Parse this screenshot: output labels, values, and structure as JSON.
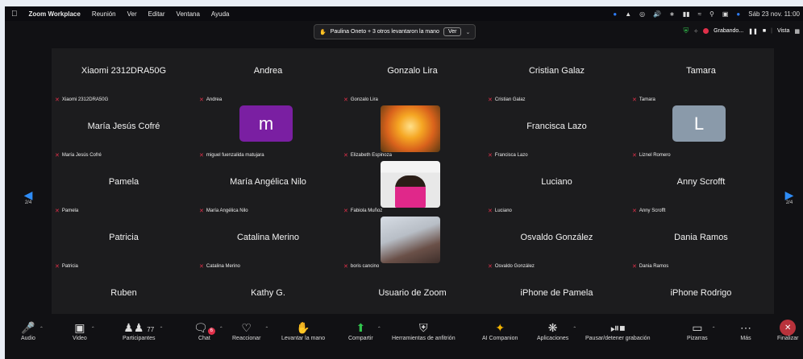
{
  "menubar": {
    "apple": "",
    "app_name": "Zoom Workplace",
    "items": [
      "Reunión",
      "Ver",
      "Editar",
      "Ventana",
      "Ayuda"
    ],
    "datetime": "Sáb 23 nov. 11:00"
  },
  "hand_banner": {
    "text": "Paulina Oneto + 3 otros levantaron la mano",
    "button": "Ver"
  },
  "status": {
    "recording": "Grabando...",
    "view": "Vista"
  },
  "pagination": {
    "left": "2/4",
    "right": "2/4"
  },
  "tiles": [
    {
      "big": "Xiaomi 2312DRA50G",
      "label": "Xiaomi 2312DRA50G"
    },
    {
      "big": "Andrea",
      "label": "Andrea"
    },
    {
      "big": "Gonzalo Lira",
      "label": "Gonzalo Lira"
    },
    {
      "big": "Cristian Galaz",
      "label": "Cristian Galaz"
    },
    {
      "big": "Tamara",
      "label": "Tamara"
    },
    {
      "big": "María Jesús Cofré",
      "label": "María Jesús Cofré"
    },
    {
      "avatar": "m",
      "label": "miguel fuenzalida matujara"
    },
    {
      "video": "sunset",
      "label": "Elizabeth Espinoza"
    },
    {
      "big": "Francisca Lazo",
      "label": "Francisca Lazo"
    },
    {
      "avatar": "L",
      "label": "Liznel Romero"
    },
    {
      "big": "Pamela",
      "label": "Pamela"
    },
    {
      "big": "María Angélica Nilo",
      "label": "María Angélica Nilo"
    },
    {
      "video": "person-pink",
      "label": "Fabiola Muñoz"
    },
    {
      "big": "Luciano",
      "label": "Luciano"
    },
    {
      "big": "Anny Scrofft",
      "label": "Anny Scrofft"
    },
    {
      "big": "Patricia",
      "label": "Patricia"
    },
    {
      "big": "Catalina Merino",
      "label": "Catalina Merino"
    },
    {
      "video": "person-room",
      "label": "boris cancino"
    },
    {
      "big": "Osvaldo González",
      "label": "Osvaldo González"
    },
    {
      "big": "Dania Ramos",
      "label": "Dania Ramos"
    },
    {
      "big": "Ruben",
      "label": "Ruben"
    },
    {
      "big": "Kathy G.",
      "label": "Kathy G."
    },
    {
      "big": "Usuario de Zoom",
      "label": "Usuario de Zoom"
    },
    {
      "big": "iPhone de Pamela",
      "label": "iPhone de Pamela"
    },
    {
      "big": "iPhone Rodrigo",
      "label": "iPhone Rodrigo"
    }
  ],
  "toolbar": {
    "audio": "Audio",
    "video": "Video",
    "participants": "Participantes",
    "participants_count": "77",
    "chat": "Chat",
    "chat_badge": "6",
    "react": "Reaccionar",
    "raise_hand": "Levantar la mano",
    "share": "Compartir",
    "host_tools": "Herramientas de anfitrión",
    "ai_companion": "AI Companion",
    "apps": "Aplicaciones",
    "pause_rec": "Pausar/detener grabación",
    "whiteboards": "Pizarras",
    "more": "Más",
    "end": "Finalizar"
  },
  "colors": {
    "mic_off": "#e0304a",
    "accent_blue": "#2e8cf6",
    "avatar_m": "#7a1fa2",
    "avatar_L": "#8a9aaa"
  }
}
